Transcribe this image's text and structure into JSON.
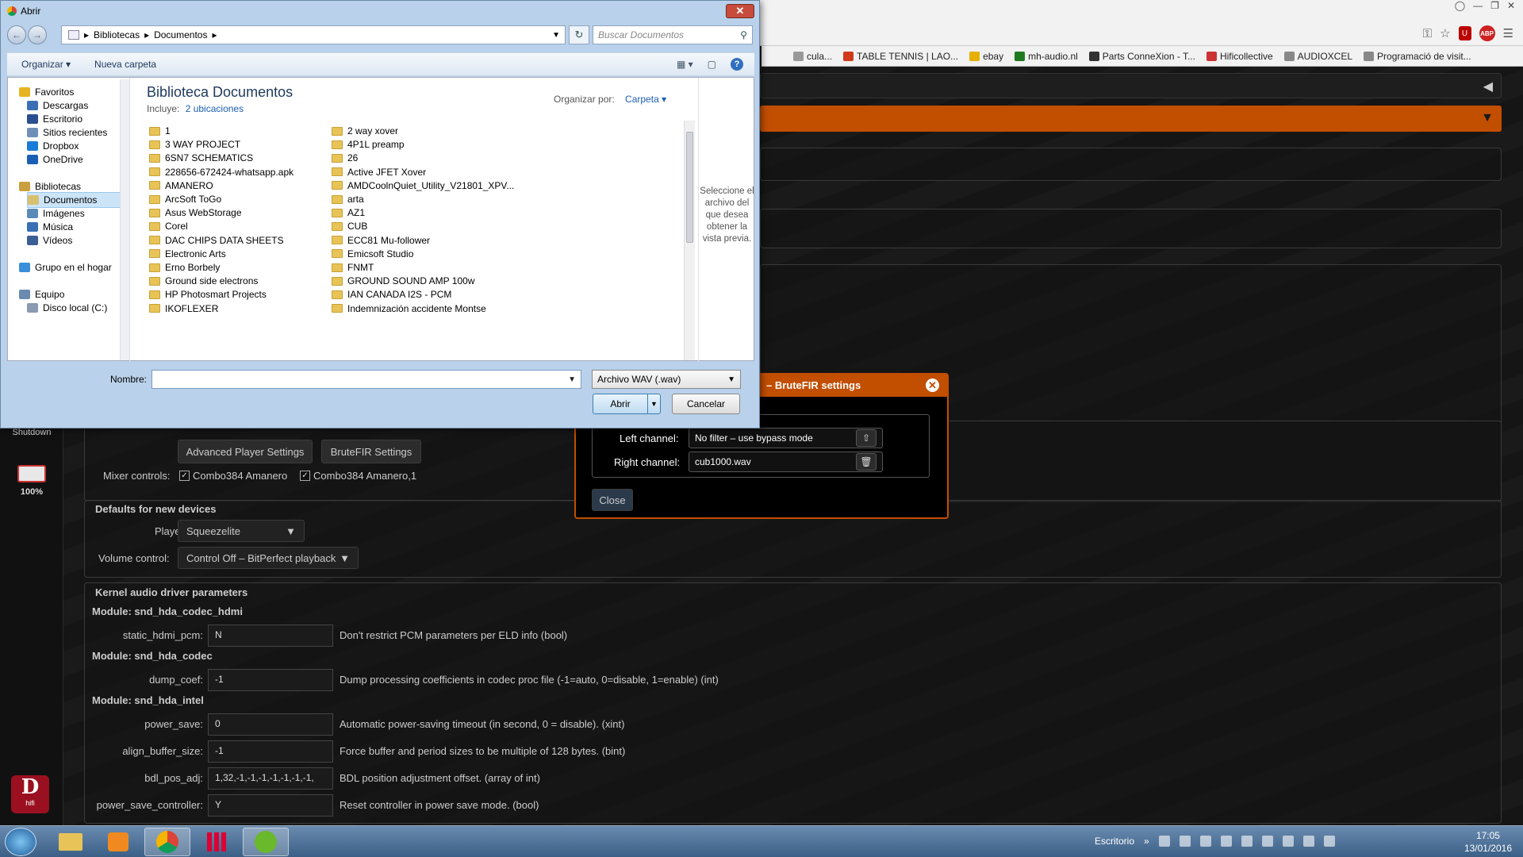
{
  "browser": {
    "bookmarks": [
      {
        "label": "cula...",
        "color": "#999999"
      },
      {
        "label": "TABLE TENNIS | LAO...",
        "color": "#d03a1a"
      },
      {
        "label": "ebay",
        "color": "#e5b000"
      },
      {
        "label": "mh-audio.nl",
        "color": "#1f7a1f"
      },
      {
        "label": "Parts ConneXion - T...",
        "color": "#333333"
      },
      {
        "label": "Hificollective",
        "color": "#c33"
      },
      {
        "label": "AUDIOXCEL",
        "color": "#888888"
      },
      {
        "label": "Programació de visit...",
        "color": "#888888"
      }
    ],
    "abp_label": "ABP"
  },
  "dialog": {
    "title": "Abrir",
    "breadcrumb": [
      "Bibliotecas",
      "Documentos"
    ],
    "search_placeholder": "Buscar Documentos",
    "organize": "Organizar",
    "new_folder": "Nueva carpeta",
    "library_title": "Biblioteca Documentos",
    "includes_label": "Incluye:",
    "includes_value": "2 ubicaciones",
    "arrange_label": "Organizar por:",
    "arrange_value": "Carpeta",
    "nav": [
      {
        "label": "Favoritos",
        "header": true,
        "color": "#e6b422"
      },
      {
        "label": "Descargas",
        "color": "#3a6fb5"
      },
      {
        "label": "Escritorio",
        "color": "#2a4f8f"
      },
      {
        "label": "Sitios recientes",
        "color": "#6f8fb8"
      },
      {
        "label": "Dropbox",
        "color": "#1a7cd8"
      },
      {
        "label": "OneDrive",
        "color": "#1a5fb4"
      },
      {
        "label": "Bibliotecas",
        "header": true,
        "color": "#c8a040"
      },
      {
        "label": "Documentos",
        "selected": true,
        "color": "#d8c070"
      },
      {
        "label": "Imágenes",
        "color": "#5a8ab8"
      },
      {
        "label": "Música",
        "color": "#3a6fb5"
      },
      {
        "label": "Vídeos",
        "color": "#3a5f95"
      },
      {
        "label": "Grupo en el hogar",
        "header": true,
        "color": "#3a8fd8"
      },
      {
        "label": "Equipo",
        "header": true,
        "color": "#6a8ab0"
      },
      {
        "label": "Disco local (C:)",
        "color": "#8a9ab0"
      }
    ],
    "files_col1": [
      "1",
      "3 WAY PROJECT",
      "6SN7 SCHEMATICS",
      "228656-672424-whatsapp.apk",
      "AMANERO",
      "ArcSoft ToGo",
      "Asus WebStorage",
      "Corel",
      "DAC CHIPS DATA SHEETS",
      "Electronic Arts",
      "Erno Borbely",
      "Ground side electrons",
      "HP Photosmart Projects",
      "IKOFLEXER"
    ],
    "files_col2": [
      "2 way xover",
      "4P1L preamp",
      "26",
      "Active JFET Xover",
      "AMDCoolnQuiet_Utility_V21801_XPV...",
      "arta",
      "AZ1",
      "CUB",
      "ECC81 Mu-follower",
      "Emicsoft Studio",
      "FNMT",
      "GROUND SOUND AMP 100w",
      "IAN CANADA I2S -  PCM",
      "Indemnización accidente  Montse"
    ],
    "preview_text": "Seleccione el archivo del que desea obtener la vista previa.",
    "filename_label": "Nombre:",
    "filename_value": "",
    "filetype": "Archivo WAV (.wav)",
    "open_button": "Abrir",
    "cancel_button": "Cancelar"
  },
  "sidebar": {
    "shutdown": "Shutdown",
    "battery": "100%",
    "logo_text": "hifi"
  },
  "player_section": {
    "advanced_btn": "Advanced Player Settings",
    "brutefir_btn": "BruteFIR Settings",
    "mixer_label": "Mixer controls:",
    "mixer_items": [
      {
        "label": "Combo384 Amanero",
        "checked": true
      },
      {
        "label": "Combo384 Amanero,1",
        "checked": true
      }
    ]
  },
  "defaults": {
    "title": "Defaults for new devices",
    "player_label": "Player:",
    "player_value": "Squeezelite",
    "volume_label": "Volume control:",
    "volume_value": "Control Off – BitPerfect playback"
  },
  "kernel": {
    "title": "Kernel audio driver parameters",
    "rows": [
      {
        "module": "Module: snd_hda_codec_hdmi"
      },
      {
        "name": "static_hdmi_pcm:",
        "value": "N",
        "desc": "Don't restrict PCM parameters per ELD info (bool)"
      },
      {
        "module": "Module: snd_hda_codec"
      },
      {
        "name": "dump_coef:",
        "value": "-1",
        "desc": "Dump processing coefficients in codec proc file (-1=auto, 0=disable, 1=enable) (int)"
      },
      {
        "module": "Module: snd_hda_intel"
      },
      {
        "name": "power_save:",
        "value": "0",
        "desc": "Automatic power-saving timeout (in second, 0 = disable). (xint)"
      },
      {
        "name": "align_buffer_size:",
        "value": "-1",
        "desc": "Force buffer and period sizes to be multiple of 128 bytes. (bint)"
      },
      {
        "name": "bdl_pos_adj:",
        "value": "1,32,-1,-1,-1,-1,-1,-1,-1,",
        "desc": "BDL position adjustment offset. (array of int)"
      },
      {
        "name": "power_save_controller:",
        "value": "Y",
        "desc": "Reset controller in power save mode. (bool)"
      }
    ]
  },
  "brutefir": {
    "title": "– BruteFIR settings",
    "left_label": "Left channel:",
    "left_value": "No filter – use bypass mode",
    "right_label": "Right channel:",
    "right_value": "cub1000.wav",
    "close_btn": "Close"
  },
  "taskbar": {
    "desktop_label": "Escritorio",
    "time": "17:05",
    "date": "13/01/2016"
  }
}
